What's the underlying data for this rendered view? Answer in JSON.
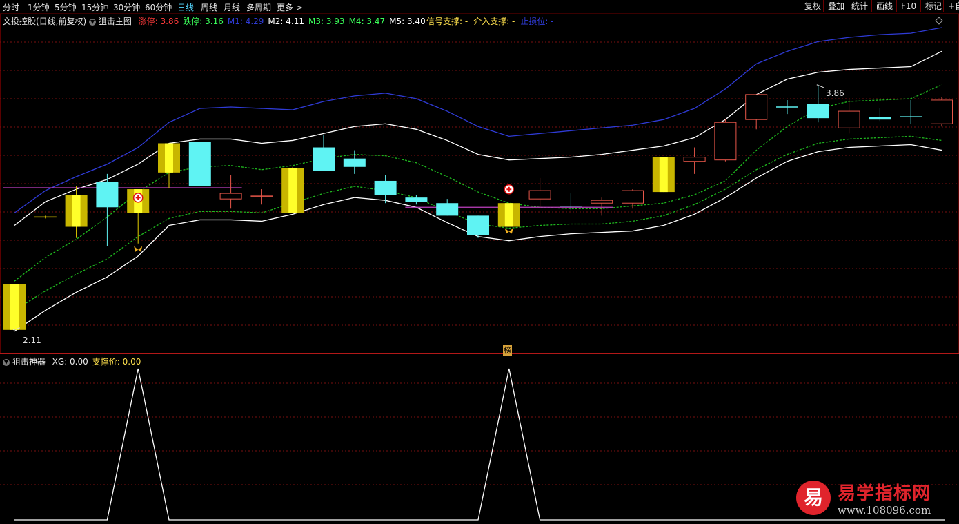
{
  "toolbar": {
    "periods": [
      "分时",
      "1分钟",
      "5分钟",
      "15分钟",
      "30分钟",
      "60分钟",
      "日线",
      "周线",
      "月线",
      "多周期",
      "更多 >"
    ],
    "active_period": "日线",
    "right_buttons": [
      "复权",
      "叠加",
      "统计",
      "画线",
      "F10",
      "标记",
      "+自"
    ]
  },
  "main_panel": {
    "stock_title": "文投控股(日线,前复权)",
    "indicator_name": "狙击主图",
    "legend": [
      {
        "label": "涨停: 3.86",
        "color": "#ff3b3b"
      },
      {
        "label": "跌停: 3.16",
        "color": "#3bff5a"
      },
      {
        "label": "M1: 4.29",
        "color": "#2f3bd6"
      },
      {
        "label": "M2: 4.11",
        "color": "#ffffff"
      },
      {
        "label": "M3: 3.93",
        "color": "#3bff5a"
      },
      {
        "label": "M4: 3.47",
        "color": "#3bff5a"
      },
      {
        "label": "M5: 3.40",
        "color": "#ffffff"
      }
    ],
    "legend2": [
      {
        "label": "信号支撑: -",
        "color": "#ffe14d"
      },
      {
        "label": "介入支撑: -",
        "color": "#ffe14d"
      },
      {
        "label": "止损位: -",
        "color": "#2f3bd6"
      }
    ],
    "high_label": "3.86",
    "low_label": "2.11",
    "bottom_tag": "榜"
  },
  "sub_panel": {
    "indicator_name": "狙击神器",
    "legend": [
      {
        "label": "XG: 0.00",
        "color": "#e8e8e8"
      },
      {
        "label": "支撑价: 0.00",
        "color": "#ffe14d"
      }
    ]
  },
  "watermark": {
    "mark": "易",
    "name": "易学指标网",
    "url": "www.108096.com"
  },
  "colors": {
    "up": "#e8574a",
    "down": "#5ff3f3",
    "signal": "#e6d000",
    "grid": "#7a1010",
    "band_outer": "#2f3bd6",
    "band": "#ffffff",
    "mid": "#1fb81f",
    "level": "#c040c0"
  },
  "chart_data": {
    "type": "candlestick",
    "y_range": [
      2.0,
      4.3
    ],
    "candles": [
      {
        "o": 2.44,
        "h": 2.44,
        "l": 2.11,
        "c": 2.11,
        "kind": "signal"
      },
      {
        "o": 2.92,
        "h": 2.93,
        "l": 2.91,
        "c": 2.92,
        "kind": "doji"
      },
      {
        "o": 3.08,
        "h": 3.14,
        "l": 2.77,
        "c": 2.85,
        "kind": "signal"
      },
      {
        "o": 2.99,
        "h": 3.23,
        "l": 2.71,
        "c": 3.17,
        "kind": "down"
      },
      {
        "o": 2.95,
        "h": 2.95,
        "l": 2.73,
        "c": 3.12,
        "kind": "signal"
      },
      {
        "o": 3.45,
        "h": 3.45,
        "l": 3.13,
        "c": 3.24,
        "kind": "signal"
      },
      {
        "o": 3.46,
        "h": 3.46,
        "l": 3.14,
        "c": 3.14,
        "kind": "down"
      },
      {
        "o": 3.09,
        "h": 3.22,
        "l": 2.98,
        "c": 3.05,
        "kind": "up"
      },
      {
        "o": 3.07,
        "h": 3.12,
        "l": 3.01,
        "c": 3.07,
        "kind": "doji"
      },
      {
        "o": 2.95,
        "h": 3.28,
        "l": 2.95,
        "c": 3.27,
        "kind": "signal"
      },
      {
        "o": 3.42,
        "h": 3.51,
        "l": 3.25,
        "c": 3.25,
        "kind": "down"
      },
      {
        "o": 3.28,
        "h": 3.4,
        "l": 3.23,
        "c": 3.34,
        "kind": "down"
      },
      {
        "o": 3.18,
        "h": 3.22,
        "l": 3.02,
        "c": 3.08,
        "kind": "down"
      },
      {
        "o": 3.06,
        "h": 3.08,
        "l": 3.01,
        "c": 3.03,
        "kind": "down"
      },
      {
        "o": 3.02,
        "h": 3.05,
        "l": 2.93,
        "c": 2.93,
        "kind": "down"
      },
      {
        "o": 2.93,
        "h": 2.93,
        "l": 2.77,
        "c": 2.79,
        "kind": "down"
      },
      {
        "o": 2.85,
        "h": 3.01,
        "l": 2.86,
        "c": 3.02,
        "kind": "signal"
      },
      {
        "o": 3.05,
        "h": 3.2,
        "l": 2.99,
        "c": 3.11,
        "kind": "up"
      },
      {
        "o": 3.0,
        "h": 3.09,
        "l": 2.97,
        "c": 3.0,
        "kind": "down"
      },
      {
        "o": 3.02,
        "h": 3.06,
        "l": 2.93,
        "c": 3.04,
        "kind": "up"
      },
      {
        "o": 3.02,
        "h": 3.12,
        "l": 2.98,
        "c": 3.11,
        "kind": "up"
      },
      {
        "o": 3.1,
        "h": 3.35,
        "l": 3.1,
        "c": 3.35,
        "kind": "signal"
      },
      {
        "o": 3.32,
        "h": 3.42,
        "l": 3.23,
        "c": 3.35,
        "kind": "up"
      },
      {
        "o": 3.33,
        "h": 3.62,
        "l": 3.32,
        "c": 3.6,
        "kind": "up"
      },
      {
        "o": 3.62,
        "h": 3.75,
        "l": 3.55,
        "c": 3.8,
        "kind": "up"
      },
      {
        "o": 3.71,
        "h": 3.76,
        "l": 3.66,
        "c": 3.71,
        "kind": "doji"
      },
      {
        "o": 3.73,
        "h": 3.87,
        "l": 3.6,
        "c": 3.63,
        "kind": "down"
      },
      {
        "o": 3.56,
        "h": 3.77,
        "l": 3.52,
        "c": 3.68,
        "kind": "up"
      },
      {
        "o": 3.64,
        "h": 3.7,
        "l": 3.61,
        "c": 3.62,
        "kind": "down"
      },
      {
        "o": 3.64,
        "h": 3.76,
        "l": 3.59,
        "c": 3.64,
        "kind": "doji"
      },
      {
        "o": 3.59,
        "h": 3.78,
        "l": 3.57,
        "c": 3.76,
        "kind": "up"
      }
    ],
    "M1": [
      2.95,
      3.11,
      3.21,
      3.3,
      3.42,
      3.6,
      3.7,
      3.71,
      3.7,
      3.69,
      3.75,
      3.79,
      3.81,
      3.77,
      3.68,
      3.57,
      3.5,
      3.52,
      3.54,
      3.56,
      3.58,
      3.62,
      3.7,
      3.84,
      4.02,
      4.11,
      4.18,
      4.21,
      4.23,
      4.24,
      4.28
    ],
    "M2": [
      2.86,
      3.03,
      3.12,
      3.19,
      3.3,
      3.45,
      3.48,
      3.48,
      3.45,
      3.47,
      3.52,
      3.57,
      3.59,
      3.55,
      3.47,
      3.37,
      3.33,
      3.34,
      3.35,
      3.37,
      3.4,
      3.43,
      3.49,
      3.62,
      3.8,
      3.91,
      3.96,
      3.98,
      3.99,
      4.0,
      4.11
    ],
    "M3": [
      2.46,
      2.63,
      2.76,
      2.92,
      3.1,
      3.24,
      3.28,
      3.29,
      3.26,
      3.29,
      3.34,
      3.37,
      3.36,
      3.31,
      3.21,
      3.1,
      3.02,
      2.99,
      2.98,
      2.98,
      3.0,
      3.02,
      3.08,
      3.18,
      3.4,
      3.57,
      3.7,
      3.75,
      3.76,
      3.77,
      3.87
    ],
    "M4": [
      2.25,
      2.39,
      2.51,
      2.62,
      2.78,
      2.91,
      2.96,
      2.96,
      2.95,
      3.02,
      3.09,
      3.14,
      3.11,
      3.06,
      2.96,
      2.87,
      2.84,
      2.86,
      2.87,
      2.87,
      2.89,
      2.93,
      3.01,
      3.12,
      3.26,
      3.37,
      3.45,
      3.48,
      3.49,
      3.5,
      3.47
    ],
    "M5": [
      2.1,
      2.25,
      2.38,
      2.49,
      2.64,
      2.86,
      2.9,
      2.9,
      2.89,
      2.94,
      3.01,
      3.06,
      3.04,
      2.99,
      2.88,
      2.78,
      2.75,
      2.78,
      2.8,
      2.81,
      2.82,
      2.86,
      2.94,
      3.06,
      3.2,
      3.32,
      3.39,
      3.42,
      3.43,
      3.44,
      3.4
    ],
    "support_lines": [
      {
        "from": 0,
        "to": 7,
        "value": 3.13
      },
      {
        "from": 13,
        "to": 19,
        "value": 2.99
      }
    ],
    "buy_markers": [
      4,
      16
    ],
    "sub": {
      "series": "XG",
      "values": [
        0,
        0,
        0,
        0,
        1,
        0,
        0,
        0,
        0,
        0,
        0,
        0,
        0,
        0,
        0,
        0,
        1,
        0,
        0,
        0,
        0,
        0,
        0,
        0,
        0,
        0,
        0,
        0,
        0,
        0,
        0
      ],
      "range": [
        0,
        1
      ]
    }
  }
}
